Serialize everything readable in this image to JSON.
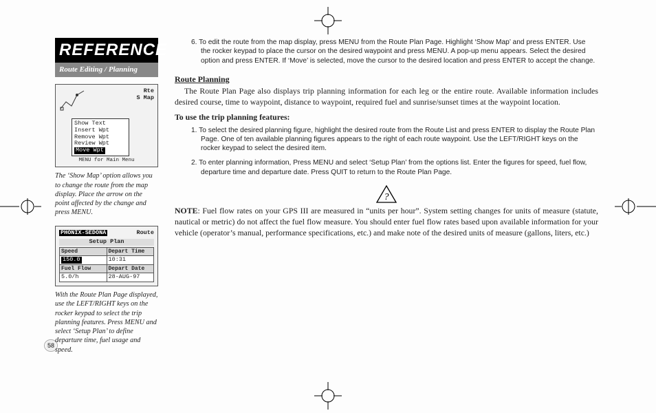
{
  "page_number": "58",
  "sidebar": {
    "banner": "REFERENCE",
    "sub": "Route Editing / Planning",
    "shot1": {
      "rte": "Rte",
      "map_tab": "S Map",
      "menu": [
        "Show Text",
        "Insert Wpt",
        "Remove Wpt",
        "Review Wpt",
        "Move Wpt"
      ],
      "footer": "MENU for Main Menu"
    },
    "caption1": "The ‘Show Map’ option allows you to change the route from the map display. Place the arrow on the point affected by the change and press MENU.",
    "shot2": {
      "title_left": "PHONIX-SEDONA",
      "title_right": "Route",
      "subtitle": "Setup Plan",
      "rows": {
        "speed_h": "Speed",
        "speed_v": "150.0",
        "time_h": "Depart Time",
        "time_v": "10:31",
        "fuel_h": "Fuel Flow",
        "fuel_v": "5.0/h",
        "date_h": "Depart Date",
        "date_v": "28-AUG-97"
      }
    },
    "caption2": "With the Route Plan Page displayed, use the LEFT/RIGHT keys on the rocker keypad to select the trip planning features. Press MENU and select ‘Setup Plan’ to define departure time, fuel usage and speed."
  },
  "main": {
    "step6": "6. To edit the route from the map display, press MENU from the Route Plan Page. Highlight ‘Show Map’ and press ENTER. Use the rocker keypad to place the cursor on the desired waypoint and press MENU. A pop-up menu appears. Select the desired option and press ENTER. If ‘Move’ is selected, move the cursor to the desired location and press ENTER to accept the change.",
    "heading1": "Route Planning",
    "para1": "The Route Plan Page also displays trip planning information for each leg or the entire route.  Available information includes desired course, time to waypoint, distance to waypoint, required fuel and sunrise/sunset times at the waypoint location.",
    "subhead": "To use the trip planning features:",
    "step1": "1. To select the desired planning figure, highlight the desired route from the Route List and press ENTER to display the Route Plan Page. One of ten available planning figures appears to the right of each route waypoint. Use the LEFT/RIGHT keys on the rocker keypad to select the desired item.",
    "step2": "2. To enter planning information, Press MENU and select ‘Setup Plan’ from the options list. Enter the figures for speed, fuel flow, departure time and departure date. Press QUIT to return to the Route Plan Page.",
    "note_label": "NOTE",
    "note": ": Fuel flow rates on your GPS III are measured in “units per hour”. System setting changes for units of measure (statute, nautical or metric) do not affect the fuel flow measure. You should enter fuel flow rates based upon available information for your vehicle (operator’s manual, performance specifications, etc.) and make note of the desired units of measure (gallons, liters, etc.)"
  }
}
